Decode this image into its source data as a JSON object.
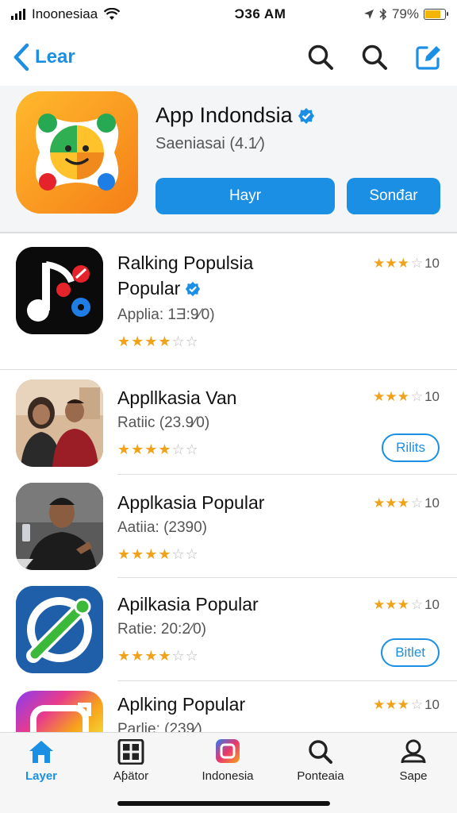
{
  "status_bar": {
    "carrier": "Inoonesiaa",
    "time": "Ɔ36 AM",
    "battery": "79%",
    "battery_level": 0.79
  },
  "nav": {
    "back_label": "Lear",
    "icons": [
      "search-icon",
      "search-icon",
      "compose-icon"
    ]
  },
  "featured": {
    "title": "App Indondsia",
    "subtitle": "Saeniasai (4.1⁄)",
    "primary_button": "Hayr",
    "secondary_button": "Sonđar"
  },
  "apps": [
    {
      "name": "Ralking Populsia",
      "name_line2": "Popular",
      "meta": "Applia: 1Ǝ:9⁄0)",
      "stars": 4,
      "rating": "10",
      "button": ""
    },
    {
      "name": "Appllkasia Van",
      "name_line2": "",
      "meta": "Ratiic (23.9⁄0)",
      "stars": 3,
      "rating": "10",
      "button": "Rilits"
    },
    {
      "name": "Applkasia Popular",
      "name_line2": "",
      "meta": "Aatiia: (2390)",
      "stars": 3,
      "rating": "10",
      "button": ""
    },
    {
      "name": "Apilkasia Popular",
      "name_line2": "",
      "meta": "Ratie: 20:2⁄0)",
      "stars": 4,
      "rating": "10",
      "button": "Bitlet"
    },
    {
      "name": "Aplking Popular",
      "name_line2": "",
      "meta": "Parlie: (239⁄)",
      "stars": 3,
      "rating": "10",
      "button": ""
    }
  ],
  "tabs": [
    {
      "label": "Layer",
      "icon": "home-icon",
      "active": true
    },
    {
      "label": "Aƥätor",
      "icon": "grid-icon",
      "active": false
    },
    {
      "label": "Indonesia",
      "icon": "app-icon",
      "active": false
    },
    {
      "label": "Ponteaia",
      "icon": "search-icon",
      "active": false
    },
    {
      "label": "Sape",
      "icon": "person-icon",
      "active": false
    }
  ],
  "colors": {
    "accent": "#1a8fe3",
    "star": "#f0a21a"
  }
}
